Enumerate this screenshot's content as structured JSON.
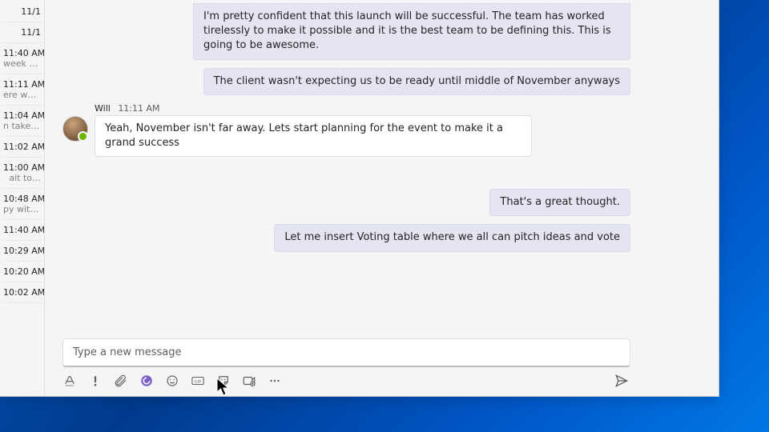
{
  "rail": {
    "items": [
      {
        "time": "11/1",
        "sub": ""
      },
      {
        "time": "11/1",
        "sub": ""
      },
      {
        "time": "11:40 AM",
        "sub": "week to…"
      },
      {
        "time": "11:11 AM",
        "sub": "ere we …"
      },
      {
        "time": "11:04 AM",
        "sub": "n take t…"
      },
      {
        "time": "11:02 AM",
        "sub": ""
      },
      {
        "time": "11:00 AM",
        "sub": "ait to…"
      },
      {
        "time": "10:48 AM",
        "sub": "py with…"
      },
      {
        "time": "11:40 AM",
        "sub": ""
      },
      {
        "time": "10:29 AM",
        "sub": ""
      },
      {
        "time": "10:20 AM",
        "sub": ""
      },
      {
        "time": "10:02 AM",
        "sub": ""
      }
    ]
  },
  "messages": {
    "m0": {
      "text": "I'm pretty confident that this launch will be successful. The team has worked tirelessly to make it possible and it is the best team to be defining this. This is going to be awesome."
    },
    "m1": {
      "text": "The client wasn't expecting us to be ready until middle of November anyways"
    },
    "m2": {
      "sender": "Will",
      "time": "11:11 AM",
      "text": "Yeah, November isn't far away. Lets start planning for the event to make it a grand success"
    },
    "m3": {
      "text": "That's a great thought."
    },
    "m4": {
      "text": "Let me insert Voting table where we all can pitch ideas and vote"
    }
  },
  "composer": {
    "placeholder": "Type a new message"
  },
  "toolbar": {
    "format": "Format",
    "priority": "Set delivery options",
    "attach": "Attach files",
    "loop": "Loop components",
    "emoji": "Emoji",
    "gif": "GIF",
    "sticker": "Sticker",
    "stream": "Stream",
    "more": "More options",
    "send": "Send"
  },
  "colors": {
    "accent": "#6264a7",
    "loop": "#8661c5",
    "presence": "#6bb700"
  }
}
